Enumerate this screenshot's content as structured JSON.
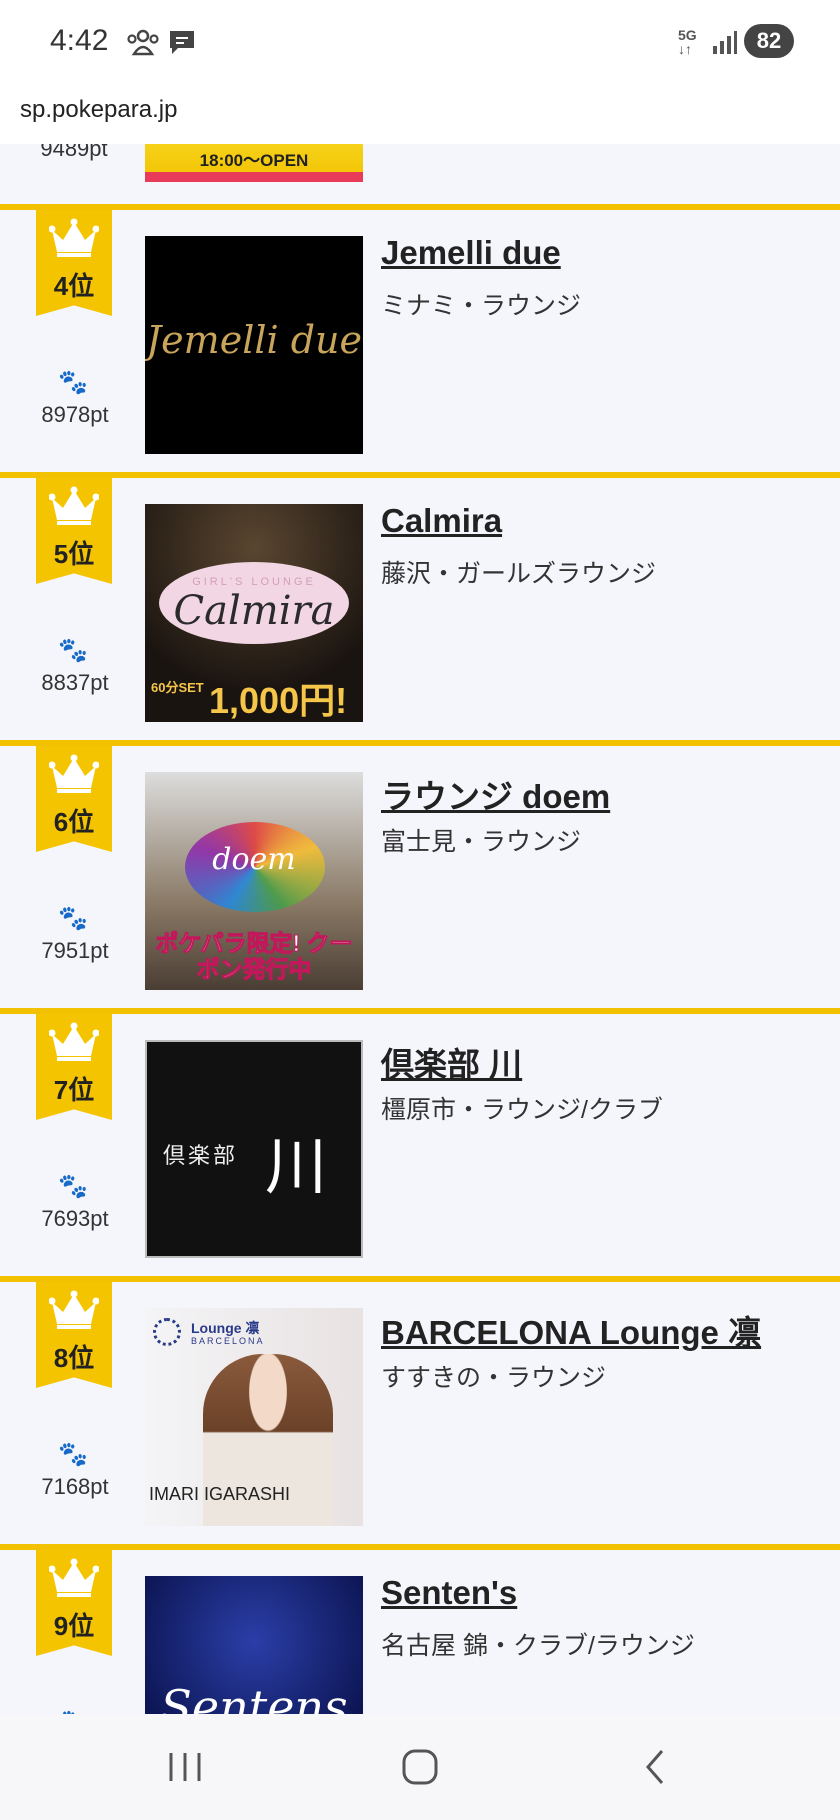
{
  "status_bar": {
    "time": "4:42",
    "network": "5G",
    "battery": "82"
  },
  "browser": {
    "url": "sp.pokepara.jp"
  },
  "partial_item": {
    "points": "9489pt",
    "banner_text": "18:00～OPEN"
  },
  "rankings": [
    {
      "rank": "4位",
      "points": "8978pt",
      "name": "Jemelli due",
      "area": "ミナミ・ラウンジ"
    },
    {
      "rank": "5位",
      "points": "8837pt",
      "name": "Calmira",
      "area": "藤沢・ガールズラウンジ"
    },
    {
      "rank": "6位",
      "points": "7951pt",
      "name": "ラウンジ doem",
      "area": "富士見・ラウンジ"
    },
    {
      "rank": "7位",
      "points": "7693pt",
      "name": "倶楽部 川",
      "area": "橿原市・ラウンジ/クラブ"
    },
    {
      "rank": "8位",
      "points": "7168pt",
      "name": "BARCELONA Lounge 凛",
      "area": "すすきの・ラウンジ"
    },
    {
      "rank": "9位",
      "points": "",
      "name": "Senten's",
      "area": "名古屋 錦・クラブ/ラウンジ"
    }
  ],
  "thumb_text": {
    "jemelli": "Jemelli due",
    "calmira_sub": "GIRL'S LOUNGE",
    "calmira": "Calmira",
    "calmira_set": "60分SET",
    "calmira_price": "1,000円!",
    "doem": "doem",
    "doem_coupon": "ポケパラ限定! クーポン発行中",
    "club": "倶楽部",
    "club_kawa": "川",
    "barca_logo": "Lounge 凛",
    "barca_sub": "BARCELONA",
    "barca_person": "IMARI IGARASHI",
    "sentens": "Sentens"
  },
  "icons": {
    "crown": "crown-icon",
    "paw": "paw-icon"
  },
  "colors": {
    "accent_yellow": "#f2c200",
    "paw_blue": "#1e6fd0",
    "background": "#f5f6fc"
  }
}
